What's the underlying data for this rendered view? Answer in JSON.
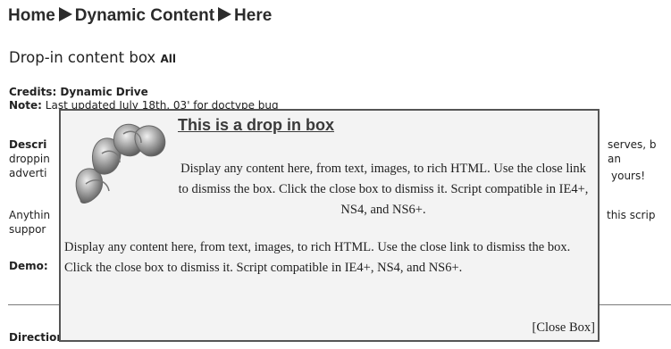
{
  "breadcrumb": {
    "home": "Home",
    "section": "Dynamic Content",
    "current": "Here"
  },
  "page_title": "Drop-in content box",
  "page_title_tag": "All",
  "credits": "Credits: Dynamic Drive",
  "note_label": "Note:",
  "note_text": "Last updated July 18th, 03' for doctype bug",
  "description_label": "Descri",
  "description_lines": [
    "droppin",
    "adverti"
  ],
  "description_right": [
    "serves, b",
    "an",
    "yours!"
  ],
  "anything_lines": [
    "Anythin",
    "suppor"
  ],
  "anything_right": "this scrip",
  "demo_label": "Demo:",
  "directions_label": "Directions:",
  "dropin": {
    "heading": "This is a drop in box",
    "body1": "Display any content here, from text, images, to rich HTML. Use the close link to dismiss the box. Click the close box to dismiss it. Script compatible in IE4+, NS4, and NS6+.",
    "body2": "Display any content here, from text, images, to rich HTML. Use the close link to dismiss the box. Click the close box to dismiss it. Script compatible in IE4+, NS4, and NS6+.",
    "close_label": "[Close Box]"
  }
}
